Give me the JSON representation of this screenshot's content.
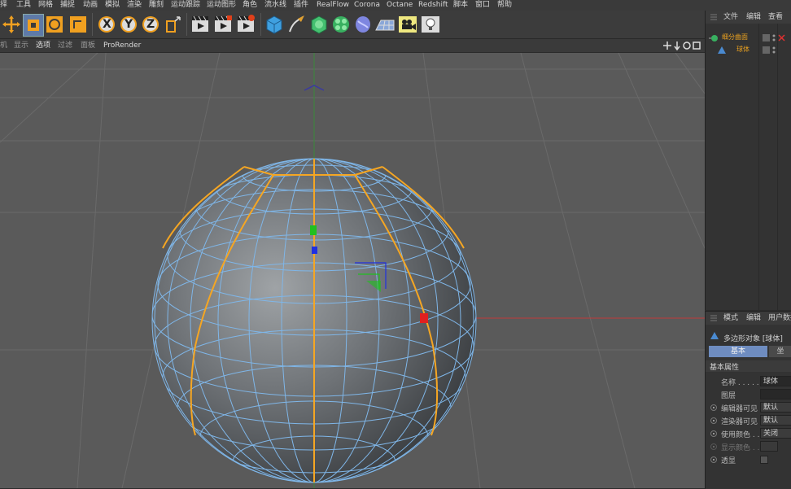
{
  "menubar": {
    "items": [
      "择",
      "工具",
      "网格",
      "捕捉",
      "动画",
      "模拟",
      "渲染",
      "雕刻",
      "运动跟踪",
      "运动图形",
      "角色",
      "流水线",
      "插件",
      "RealFlow",
      "Corona",
      "Octane",
      "Redshift",
      "脚本",
      "窗口",
      "帮助"
    ]
  },
  "toolbar": {
    "buttons": [
      "move-icon",
      "scale-icon",
      "rotate-icon",
      "last-tool-icon",
      "x-axis-icon",
      "y-axis-icon",
      "z-axis-icon",
      "coord-system-icon",
      "render-view-icon",
      "render-picture-icon",
      "render-settings-icon",
      "cube-icon",
      "pen-icon",
      "subdivision-icon",
      "cloner-icon",
      "deformer-icon",
      "floor-icon",
      "camera-icon",
      "light-icon"
    ],
    "x_label": "X",
    "y_label": "Y",
    "z_label": "Z"
  },
  "viewport_header": {
    "items": [
      "机",
      "显示",
      "选项",
      "过滤",
      "面板",
      "ProRender"
    ],
    "nav_icons": [
      "move-view-icon",
      "zoom-view-icon",
      "rotate-view-icon",
      "maximize-view-icon"
    ]
  },
  "object_manager": {
    "tabs": [
      "文件",
      "编辑",
      "查看"
    ],
    "objects": [
      {
        "name": "细分曲面",
        "color": "#e8a020"
      },
      {
        "name": "球体",
        "color": "#e8a020"
      }
    ]
  },
  "attribute_manager": {
    "tabs": [
      "模式",
      "编辑",
      "用户数据"
    ],
    "object_title": "多边形对象 [球体]",
    "section_tabs": [
      "基本",
      "坐"
    ],
    "group_title": "基本属性",
    "fields": [
      {
        "label": "名称 . . . . .",
        "value": "球体",
        "radio": false
      },
      {
        "label": "图层",
        "value": "",
        "radio": false
      },
      {
        "label": "编辑器可见",
        "value": "默认",
        "radio": true
      },
      {
        "label": "渲染器可见",
        "value": "默认",
        "radio": true
      },
      {
        "label": "使用颜色 . .",
        "value": "关闭",
        "radio": true
      },
      {
        "label": "显示颜色 . .",
        "value": "",
        "radio": true
      },
      {
        "label": "透显",
        "value": "",
        "radio": true
      }
    ]
  },
  "colors": {
    "selection_edge": "#f5a623",
    "wireframe": "#7fb6e8",
    "x_axis": "#e02020",
    "y_axis": "#20c020",
    "z_axis": "#2030e0"
  }
}
